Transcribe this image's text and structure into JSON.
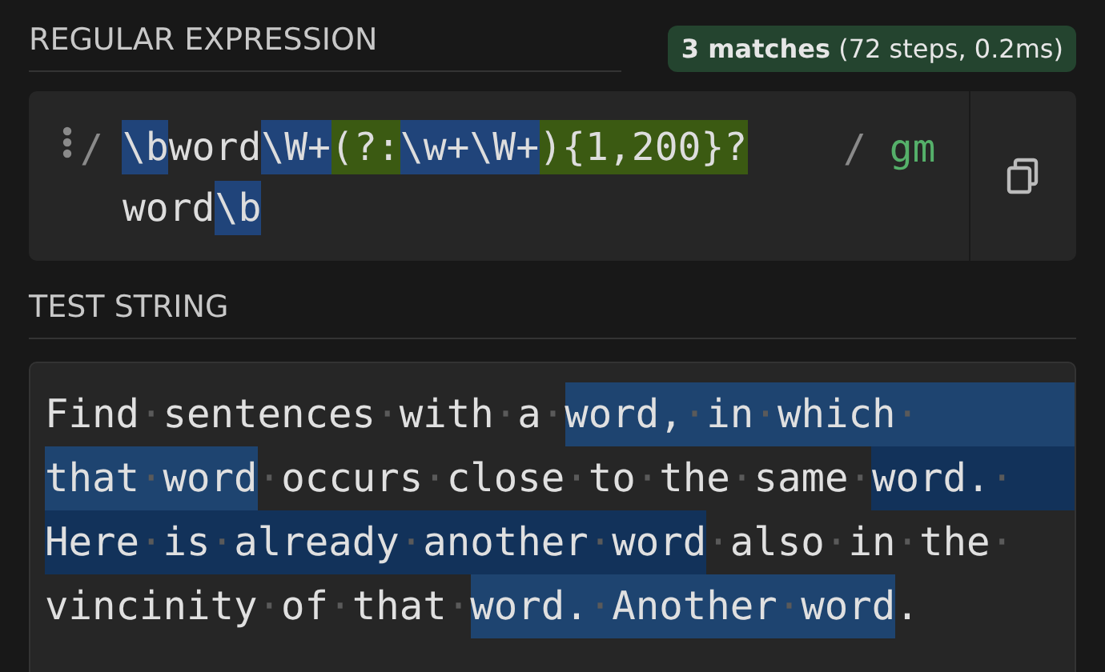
{
  "regex_section": {
    "title": "REGULAR EXPRESSION",
    "result": {
      "count": "3 matches",
      "detail": "(72 steps, 0.2ms)"
    },
    "delimiter": "/",
    "flags_delimiter": "/",
    "flags": "gm",
    "lines": [
      [
        {
          "kind": "escape",
          "text": "\\b"
        },
        {
          "kind": "plain",
          "text": "word"
        },
        {
          "kind": "escape",
          "text": "\\W+"
        },
        {
          "kind": "group",
          "text": "(?:"
        },
        {
          "kind": "escape",
          "text": "\\w+\\W+"
        },
        {
          "kind": "group",
          "text": "){1,200}?"
        }
      ],
      [
        {
          "kind": "plain",
          "text": "word"
        },
        {
          "kind": "escape",
          "text": "\\b"
        }
      ]
    ]
  },
  "test_section": {
    "title": "TEST STRING",
    "lines": [
      {
        "fill_to_end": true,
        "segments": [
          {
            "kind": "plain",
            "text": "Find·sentences·with·a·"
          },
          {
            "kind": "match_a",
            "text": "word,·in·which·"
          }
        ]
      },
      {
        "fill_to_end": true,
        "segments": [
          {
            "kind": "match_a",
            "text": "that·word"
          },
          {
            "kind": "plain",
            "text": "·occurs·close·to·the·same·"
          },
          {
            "kind": "match_b",
            "text": "word.·"
          }
        ]
      },
      {
        "segments": [
          {
            "kind": "match_b",
            "text": "Here·is·already·another·word"
          },
          {
            "kind": "plain",
            "text": "·also·in·the·"
          }
        ]
      },
      {
        "segments": [
          {
            "kind": "plain",
            "text": "vincinity·of·that·"
          },
          {
            "kind": "match_a",
            "text": "word.·Another·word"
          },
          {
            "kind": "plain",
            "text": "."
          }
        ]
      }
    ]
  }
}
